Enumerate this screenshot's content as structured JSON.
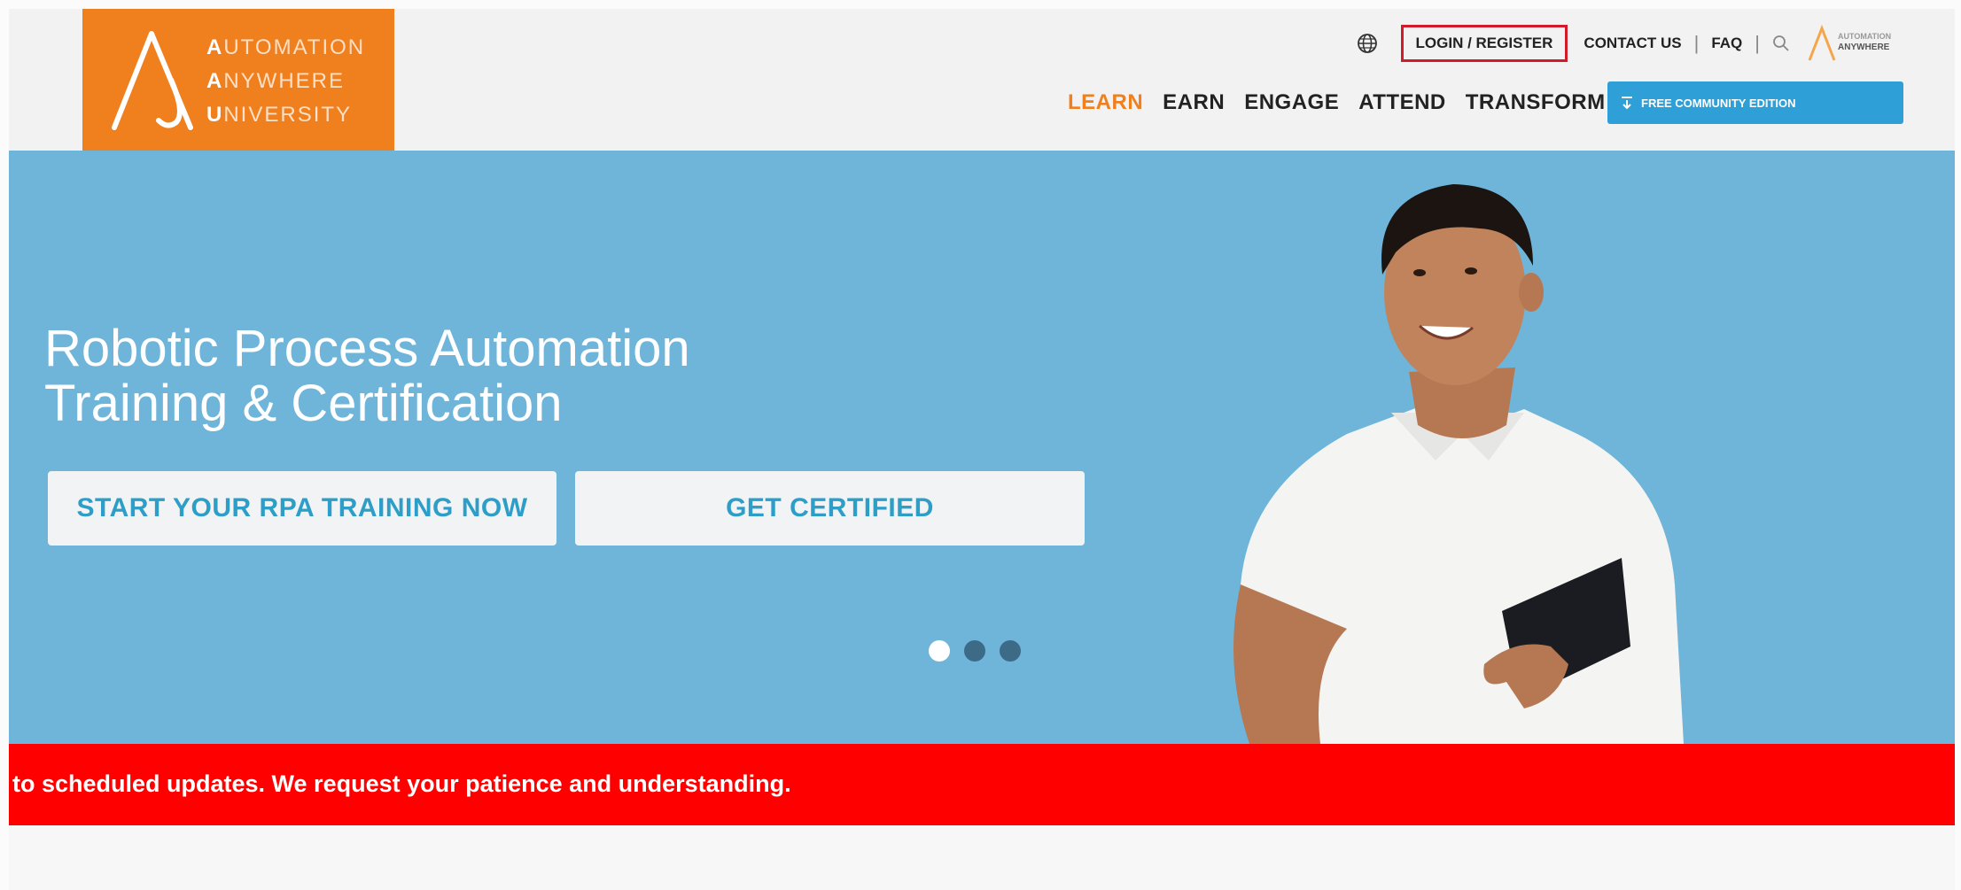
{
  "brand": {
    "line1_initial": "A",
    "line1_rest": "UTOMATION",
    "line2_initial": "A",
    "line2_rest": "NYWHERE",
    "line3_initial": "U",
    "line3_rest": "NIVERSITY",
    "accent_color": "#f07f1e"
  },
  "utility_nav": {
    "login_register": "LOGIN / REGISTER",
    "contact_us": "CONTACT US",
    "faq": "FAQ",
    "partner_logo_line1": "AUTOMATION",
    "partner_logo_line2": "ANYWHERE"
  },
  "main_nav": {
    "items": [
      {
        "label": "LEARN",
        "active": true
      },
      {
        "label": "EARN",
        "active": false
      },
      {
        "label": "ENGAGE",
        "active": false
      },
      {
        "label": "ATTEND",
        "active": false
      },
      {
        "label": "TRANSFORM",
        "active": false
      }
    ]
  },
  "free_community_button": {
    "label": "FREE COMMUNITY EDITION",
    "icon": "download-icon",
    "color": "#2f9fd8"
  },
  "hero": {
    "title_line1": "Robotic Process Automation",
    "title_line2": "Training & Certification",
    "button_primary": "START YOUR RPA TRAINING NOW",
    "button_secondary": "GET CERTIFIED",
    "background_color": "#6fb4d9",
    "carousel": {
      "total": 3,
      "active_index": 0
    }
  },
  "alert_banner": {
    "text": "to scheduled updates. We request your patience and understanding.",
    "color": "#ff0000"
  }
}
